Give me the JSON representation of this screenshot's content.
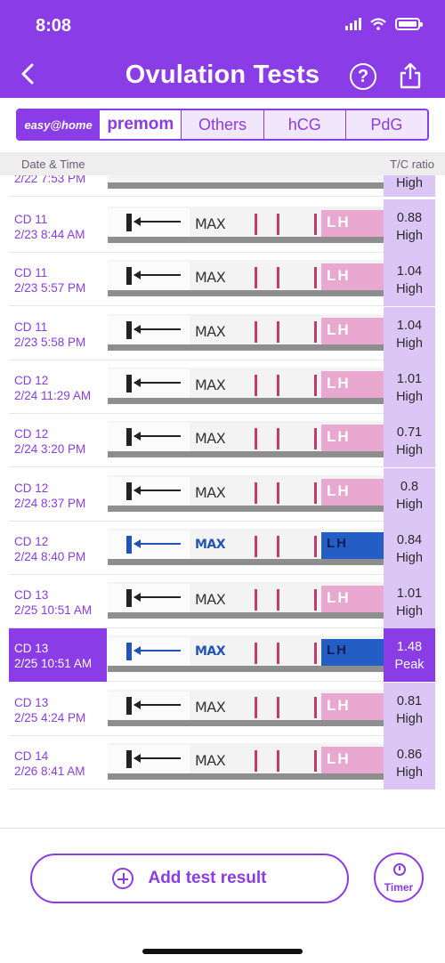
{
  "status_bar": {
    "time": "8:08"
  },
  "header": {
    "title": "Ovulation Tests",
    "help_label": "?"
  },
  "tabs": [
    {
      "label": "easy@home"
    },
    {
      "label": "premom"
    },
    {
      "label": "Others"
    },
    {
      "label": "hCG"
    },
    {
      "label": "PdG"
    }
  ],
  "columns": {
    "left": "Date & Time",
    "right": "T/C ratio"
  },
  "partial_row": {
    "datetime": "2/22 7:53 PM",
    "level": "High"
  },
  "rows": [
    {
      "cd": "CD 11",
      "datetime": "2/23 8:44 AM",
      "ratio": "0.88",
      "level": "High",
      "strip_max": "MAX"
    },
    {
      "cd": "CD 11",
      "datetime": "2/23 5:57 PM",
      "ratio": "1.04",
      "level": "High",
      "strip_max": "MAX"
    },
    {
      "cd": "CD 11",
      "datetime": "2/23 5:58 PM",
      "ratio": "1.04",
      "level": "High",
      "strip_max": "MAX"
    },
    {
      "cd": "CD 12",
      "datetime": "2/24 11:29 AM",
      "ratio": "1.01",
      "level": "High",
      "strip_max": "MAX"
    },
    {
      "cd": "CD 12",
      "datetime": "2/24 3:20 PM",
      "ratio": "0.71",
      "level": "High",
      "strip_max": "MAX"
    },
    {
      "cd": "CD 12",
      "datetime": "2/24 8:37 PM",
      "ratio": "0.8",
      "level": "High",
      "strip_max": "MAX"
    },
    {
      "cd": "CD 12",
      "datetime": "2/24 8:40 PM",
      "ratio": "0.84",
      "level": "High",
      "strip_max": "MAX"
    },
    {
      "cd": "CD 13",
      "datetime": "2/25 10:51 AM",
      "ratio": "1.01",
      "level": "High",
      "strip_max": "MAX"
    },
    {
      "cd": "CD 13",
      "datetime": "2/25 10:51 AM",
      "ratio": "1.48",
      "level": "Peak",
      "strip_max": "MAX"
    },
    {
      "cd": "CD 13",
      "datetime": "2/25 4:24 PM",
      "ratio": "0.81",
      "level": "High",
      "strip_max": "MAX"
    },
    {
      "cd": "CD 14",
      "datetime": "2/26 8:41 AM",
      "ratio": "0.86",
      "level": "High",
      "strip_max": "MAX"
    }
  ],
  "strip_lh_label": "LH",
  "actions": {
    "add_label": "Add test result",
    "timer_label": "Timer"
  },
  "colors": {
    "accent": "#8a3ce6",
    "ratio_bg": "#dcc6f6"
  }
}
